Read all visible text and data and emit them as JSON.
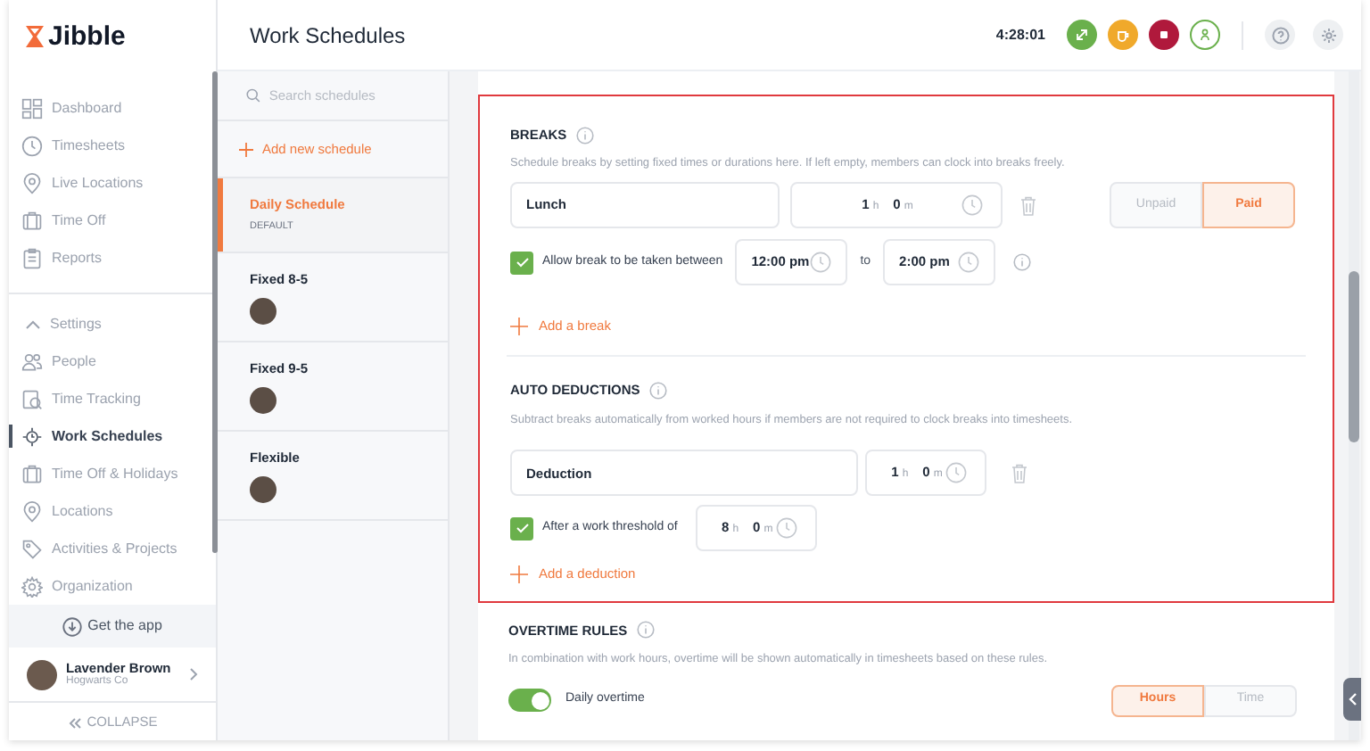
{
  "sidebar": {
    "logo": "Jibble",
    "primary_items": [
      {
        "label": "Dashboard",
        "selected": false
      },
      {
        "label": "Timesheets",
        "selected": false
      },
      {
        "label": "Live Locations",
        "selected": false
      },
      {
        "label": "Time Off",
        "selected": false
      },
      {
        "label": "Reports",
        "selected": false
      }
    ],
    "settings": {
      "label": "Settings",
      "expanded": true,
      "items": [
        {
          "label": "People",
          "selected": false
        },
        {
          "label": "Time Tracking",
          "selected": false
        },
        {
          "label": "Work Schedules",
          "selected": true
        },
        {
          "label": "Time Off & Holidays",
          "selected": false
        },
        {
          "label": "Locations",
          "selected": false
        },
        {
          "label": "Activities & Projects",
          "selected": false
        },
        {
          "label": "Organization",
          "selected": false
        }
      ]
    },
    "get_app": "Get the app",
    "user": {
      "name": "Lavender Brown",
      "company": "Hogwarts Co"
    },
    "collapse": "COLLAPSE"
  },
  "header": {
    "title": "Work Schedules",
    "timer": "4:28:01",
    "actions": [
      {
        "kind": "switch",
        "color": "#6ab04c"
      },
      {
        "kind": "break",
        "color": "#f0a92b"
      },
      {
        "kind": "stop",
        "color": "#b0193c"
      },
      {
        "kind": "person",
        "color": "#6ab04c"
      }
    ]
  },
  "schedules": {
    "search_placeholder": "Search schedules",
    "add_label": "Add new schedule",
    "items": [
      {
        "name": "Daily Schedule",
        "tag": "DEFAULT",
        "selected": true,
        "avatar": false
      },
      {
        "name": "Fixed 8-5",
        "selected": false,
        "avatar": true
      },
      {
        "name": "Fixed 9-5",
        "selected": false,
        "avatar": true
      },
      {
        "name": "Flexible",
        "selected": false,
        "avatar": true
      }
    ]
  },
  "breaks": {
    "title": "BREAKS",
    "description": "Schedule breaks by setting fixed times or durations here. If left empty, members can clock into breaks freely.",
    "items": [
      {
        "name": "Lunch",
        "hours": "1",
        "hours_unit": "h",
        "minutes": "0",
        "minutes_unit": "m",
        "pay_options": [
          {
            "label": "Unpaid",
            "selected": false
          },
          {
            "label": "Paid",
            "selected": true
          }
        ],
        "window": {
          "checked": true,
          "label": "Allow break to be taken between",
          "from": "12:00 pm",
          "joiner": "to",
          "to": "2:00 pm"
        }
      }
    ],
    "add_label": "Add a break"
  },
  "auto_deductions": {
    "title": "AUTO DEDUCTIONS",
    "description": "Subtract breaks automatically from worked hours if members are not required to clock breaks into timesheets.",
    "items": [
      {
        "name": "Deduction",
        "hours": "1",
        "hours_unit": "h",
        "minutes": "0",
        "minutes_unit": "m",
        "threshold": {
          "checked": true,
          "label": "After a work threshold of",
          "hours": "8",
          "hours_unit": "h",
          "minutes": "0",
          "minutes_unit": "m"
        }
      }
    ],
    "add_label": "Add a deduction"
  },
  "overtime": {
    "title": "OVERTIME RULES",
    "description": "In combination with work hours, overtime will be shown automatically in timesheets based on these rules.",
    "rules": [
      {
        "label": "Daily overtime",
        "on": true,
        "options": [
          {
            "label": "Hours",
            "selected": true
          },
          {
            "label": "Time",
            "selected": false
          }
        ]
      }
    ]
  }
}
